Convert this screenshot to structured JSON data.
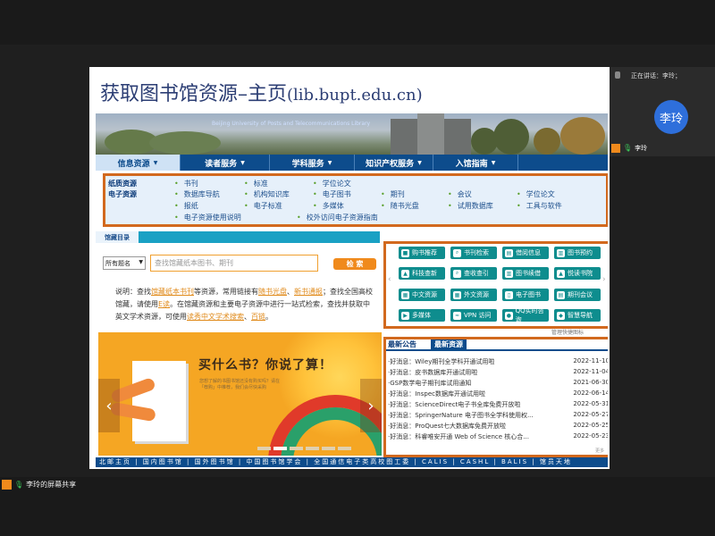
{
  "slide": {
    "title": "获取图书馆资源–主页",
    "paren_open": "(",
    "url": "lib.bupt.edu.cn",
    "paren_close": ")"
  },
  "banner": {
    "subtitle": "Beijing University of Posts and Telecommunications Library"
  },
  "nav": [
    {
      "label": "信息资源",
      "active": true
    },
    {
      "label": "读者服务",
      "active": false
    },
    {
      "label": "学科服务",
      "active": false
    },
    {
      "label": "知识产权服务",
      "active": false
    },
    {
      "label": "入馆指南",
      "active": false
    }
  ],
  "subnav": {
    "cat1": "纸质资源",
    "cat2": "电子资源",
    "row1": [
      "书刊",
      "标准",
      "学位论文"
    ],
    "row2": [
      "数据库导航",
      "机构知识库",
      "电子图书",
      "期刊",
      "会议",
      "学位论文"
    ],
    "row3": [
      "报纸",
      "电子标准",
      "多媒体",
      "随书光盘",
      "试用数据库",
      "工具与软件"
    ],
    "row4": [
      "电子资源使用说明",
      "校外访问电子资源指南"
    ]
  },
  "catalog": {
    "tab": "馆藏目录",
    "select": "所有题名",
    "placeholder": "查找馆藏纸本图书、期刊",
    "button": "检 索",
    "desc": {
      "p1": "说明：查找",
      "l1": "馆藏纸本书刊",
      "p2": "等资源，常用链接有",
      "l2": "随书光盘",
      "p3": "、",
      "l3": "新书通报",
      "p4": "；查找全国高校馆藏，请使用",
      "l4": "E读",
      "p5": "。在馆藏资源和主要电子资源中进行一站式检索，查找并获取中英文学术资源，可使用",
      "l5": "读秀中文学术搜索",
      "p6": "、",
      "l6": "百链",
      "p7": "。"
    }
  },
  "promo": {
    "title": "买什么书？你说了算！",
    "caption": "您想了解的书图书馆还没有购买吗？请在「荐购」中推荐，我们会尽快采购"
  },
  "quick": {
    "buttons": [
      "购书推荐",
      "书刊检索",
      "借阅信息",
      "图书预约",
      "科技查新",
      "查收查引",
      "图书续借",
      "悦读书院",
      "中文资源",
      "外文资源",
      "电子图书",
      "期刊会议",
      "多媒体",
      "VPN 访问",
      "QQ实时咨询",
      "智慧导航"
    ],
    "manage": "管理快捷图标"
  },
  "news": {
    "tab1": "最新公告",
    "tab2": "最新资源",
    "more": "更多",
    "items": [
      {
        "title": "·好消息：Wiley期刊全学科开通试用啦",
        "date": "2022-11-10"
      },
      {
        "title": "·好消息：皮书数据库开通试用啦",
        "date": "2022-11-04"
      },
      {
        "title": "·GSP数学电子期刊库试用通知",
        "date": "2021-06-30"
      },
      {
        "title": "·好消息：Inspec数据库开通试用啦",
        "date": "2022-06-14"
      },
      {
        "title": "·好消息：ScienceDirect电子书全库免费开放啦",
        "date": "2022-05-31"
      },
      {
        "title": "·好消息：SpringerNature 电子图书全学科使用权...",
        "date": "2022-05-27"
      },
      {
        "title": "·好消息：ProQuest七大数据库免费开放啦",
        "date": "2022-05-25"
      },
      {
        "title": "·好消息：科睿唯安开通 Web of Science 核心合...",
        "date": "2022-05-23"
      }
    ]
  },
  "footer": "北邮主页 | 国内图书馆 | 国外图书馆 | 中国图书馆学会 | 全国通信电子类高校图工委 | CALIS | CASHL | BALIS | 馆员天地",
  "meeting": {
    "speaking": "正在讲话：李玲；",
    "avatar": "李玲",
    "name": "李玲",
    "share": "李玲的屏幕共享"
  }
}
